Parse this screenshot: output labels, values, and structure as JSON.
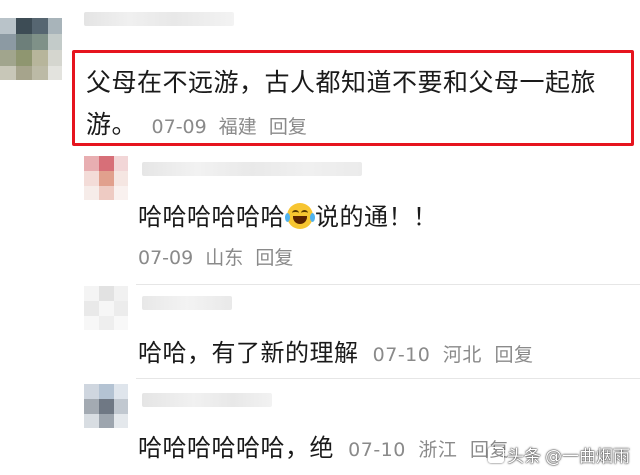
{
  "main_comment": {
    "text": "父母在不远游，古人都知道不要和父母一起旅游。",
    "date": "07-09",
    "location": "福建",
    "reply_label": "回复"
  },
  "replies": [
    {
      "text_before": "哈哈哈哈哈哈",
      "emoji": "laugh-cry-emoji",
      "text_after": "说的通！！",
      "date": "07-09",
      "location": "山东",
      "reply_label": "回复"
    },
    {
      "text": "哈哈，有了新的理解",
      "date": "07-10",
      "location": "河北",
      "reply_label": "回复"
    },
    {
      "text": "哈哈哈哈哈哈，绝",
      "date": "07-10",
      "location": "浙江",
      "reply_label": "回复"
    }
  ],
  "watermark": {
    "brand": "头条",
    "author": "@一曲烟雨"
  },
  "colors": {
    "highlight_border": "#e6141e",
    "meta_text": "#8a8a8a",
    "body_text": "#1a1a1a",
    "emoji_face": "#f7c531"
  }
}
